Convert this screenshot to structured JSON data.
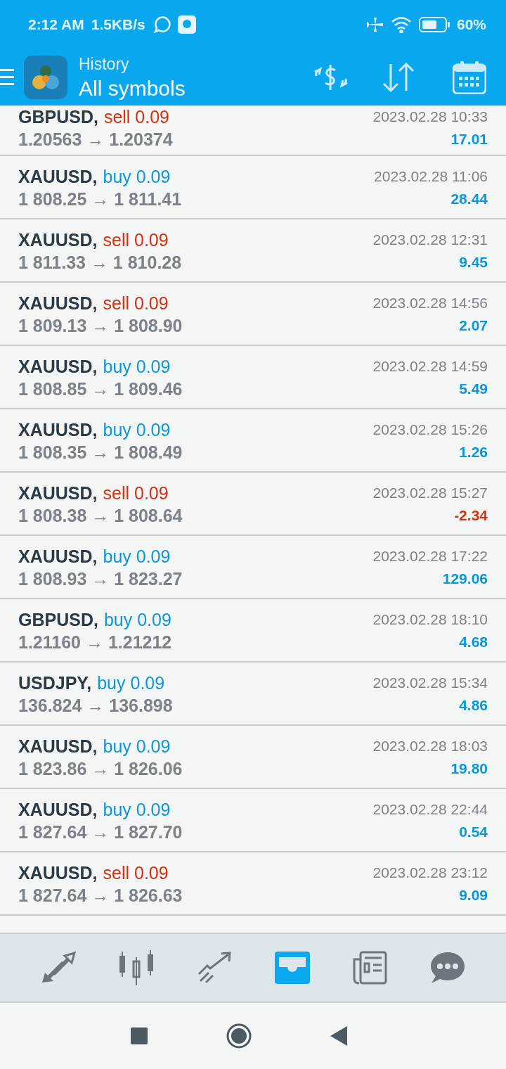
{
  "status_bar": {
    "time": "2:12 AM",
    "speed": "1.5KB/s",
    "battery": "60%"
  },
  "header": {
    "title": "History",
    "subtitle": "All symbols"
  },
  "trades": [
    {
      "symbol": "GBPUSD,",
      "sell": true,
      "trade": "sell 0.09",
      "prices": "1.20563 → 1.20374",
      "time": "2023.02.28 10:33",
      "profit": "17.01",
      "loss": false
    },
    {
      "symbol": "XAUUSD,",
      "sell": false,
      "trade": "buy 0.09",
      "prices": "1 808.25 → 1 811.41",
      "time": "2023.02.28 11:06",
      "profit": "28.44",
      "loss": false
    },
    {
      "symbol": "XAUUSD,",
      "sell": true,
      "trade": "sell 0.09",
      "prices": "1 811.33 → 1 810.28",
      "time": "2023.02.28 12:31",
      "profit": "9.45",
      "loss": false
    },
    {
      "symbol": "XAUUSD,",
      "sell": true,
      "trade": "sell 0.09",
      "prices": "1 809.13 → 1 808.90",
      "time": "2023.02.28 14:56",
      "profit": "2.07",
      "loss": false
    },
    {
      "symbol": "XAUUSD,",
      "sell": false,
      "trade": "buy 0.09",
      "prices": "1 808.85 → 1 809.46",
      "time": "2023.02.28 14:59",
      "profit": "5.49",
      "loss": false
    },
    {
      "symbol": "XAUUSD,",
      "sell": false,
      "trade": "buy 0.09",
      "prices": "1 808.35 → 1 808.49",
      "time": "2023.02.28 15:26",
      "profit": "1.26",
      "loss": false
    },
    {
      "symbol": "XAUUSD,",
      "sell": true,
      "trade": "sell 0.09",
      "prices": "1 808.38 → 1 808.64",
      "time": "2023.02.28 15:27",
      "profit": "-2.34",
      "loss": true
    },
    {
      "symbol": "XAUUSD,",
      "sell": false,
      "trade": "buy 0.09",
      "prices": "1 808.93 → 1 823.27",
      "time": "2023.02.28 17:22",
      "profit": "129.06",
      "loss": false
    },
    {
      "symbol": "GBPUSD,",
      "sell": false,
      "trade": "buy 0.09",
      "prices": "1.21160 → 1.21212",
      "time": "2023.02.28 18:10",
      "profit": "4.68",
      "loss": false
    },
    {
      "symbol": "USDJPY,",
      "sell": false,
      "trade": "buy 0.09",
      "prices": "136.824 → 136.898",
      "time": "2023.02.28 15:34",
      "profit": "4.86",
      "loss": false
    },
    {
      "symbol": "XAUUSD,",
      "sell": false,
      "trade": "buy 0.09",
      "prices": "1 823.86 → 1 826.06",
      "time": "2023.02.28 18:03",
      "profit": "19.80",
      "loss": false
    },
    {
      "symbol": "XAUUSD,",
      "sell": false,
      "trade": "buy 0.09",
      "prices": "1 827.64 → 1 827.70",
      "time": "2023.02.28 22:44",
      "profit": "0.54",
      "loss": false
    },
    {
      "symbol": "XAUUSD,",
      "sell": true,
      "trade": "sell 0.09",
      "prices": "1 827.64 → 1 826.63",
      "time": "2023.02.28 23:12",
      "profit": "9.09",
      "loss": false
    }
  ],
  "tabs": [
    {
      "kind": "trade",
      "selected": false
    },
    {
      "kind": "chart",
      "selected": false
    },
    {
      "kind": "trend",
      "selected": false
    },
    {
      "kind": "history",
      "selected": true
    },
    {
      "kind": "news",
      "selected": false
    },
    {
      "kind": "chat",
      "selected": false
    }
  ]
}
